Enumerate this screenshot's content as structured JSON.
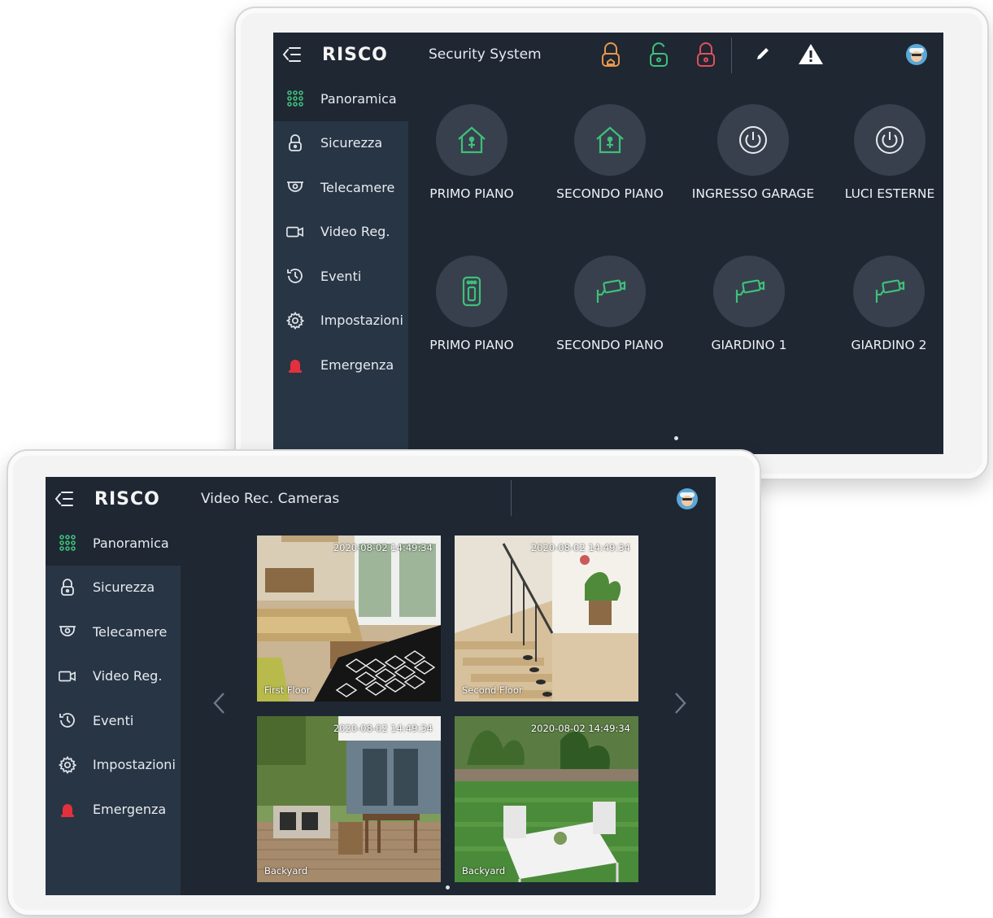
{
  "back_panel": {
    "menu_icon": "menu-collapse-icon",
    "logo": "RISCO",
    "title": "Security System",
    "status_icons": [
      "arm-away-lock-icon",
      "disarmed-lock-icon",
      "armed-lock-icon"
    ],
    "status_colors": {
      "partial": "#e8974a",
      "disarmed": "#3fbf7a",
      "armed": "#e0505a"
    },
    "edit_icon": "pencil-icon",
    "alert_icon": "warning-icon",
    "nav": [
      {
        "label": "Panoramica",
        "icon": "grid-dots-icon"
      },
      {
        "label": "Sicurezza",
        "icon": "lock-icon"
      },
      {
        "label": "Telecamere",
        "icon": "dome-camera-icon"
      },
      {
        "label": "Video Reg.",
        "icon": "video-camera-icon"
      },
      {
        "label": "Eventi",
        "icon": "history-icon"
      },
      {
        "label": "Impostazioni",
        "icon": "gear-icon"
      },
      {
        "label": "Emergenza",
        "icon": "siren-icon"
      }
    ],
    "tiles_row1": [
      {
        "label": "PRIMO PIANO",
        "icon": "home-icon"
      },
      {
        "label": "SECONDO PIANO",
        "icon": "home-icon"
      },
      {
        "label": "INGRESSO GARAGE",
        "icon": "power-icon"
      },
      {
        "label": "LUCI ESTERNE",
        "icon": "power-icon"
      }
    ],
    "tiles_row2": [
      {
        "label": "PRIMO PIANO",
        "icon": "intercom-icon"
      },
      {
        "label": "SECONDO PIANO",
        "icon": "camera-icon"
      },
      {
        "label": "GIARDINO 1",
        "icon": "camera-icon"
      },
      {
        "label": "GIARDINO 2",
        "icon": "camera-icon"
      }
    ],
    "accent": "#3fbf7a"
  },
  "front_panel": {
    "logo": "RISCO",
    "title": "Video Rec. Cameras",
    "nav": [
      {
        "label": "Panoramica",
        "icon": "grid-dots-icon"
      },
      {
        "label": "Sicurezza",
        "icon": "lock-icon"
      },
      {
        "label": "Telecamere",
        "icon": "dome-camera-icon"
      },
      {
        "label": "Video Reg.",
        "icon": "video-camera-icon"
      },
      {
        "label": "Eventi",
        "icon": "history-icon"
      },
      {
        "label": "Impostazioni",
        "icon": "gear-icon"
      },
      {
        "label": "Emergenza",
        "icon": "siren-icon"
      }
    ],
    "cameras": [
      {
        "name": "First Floor",
        "timestamp": "2020-08-02   14:49:34"
      },
      {
        "name": "Second Floor",
        "timestamp": "2020-08-02   14:49:34"
      },
      {
        "name": "Backyard",
        "timestamp": "2020-08-02   14:49:34"
      },
      {
        "name": "Backyard",
        "timestamp": "2020-08-02   14:49:34"
      }
    ],
    "prev_icon": "chevron-left-icon",
    "next_icon": "chevron-right-icon"
  }
}
